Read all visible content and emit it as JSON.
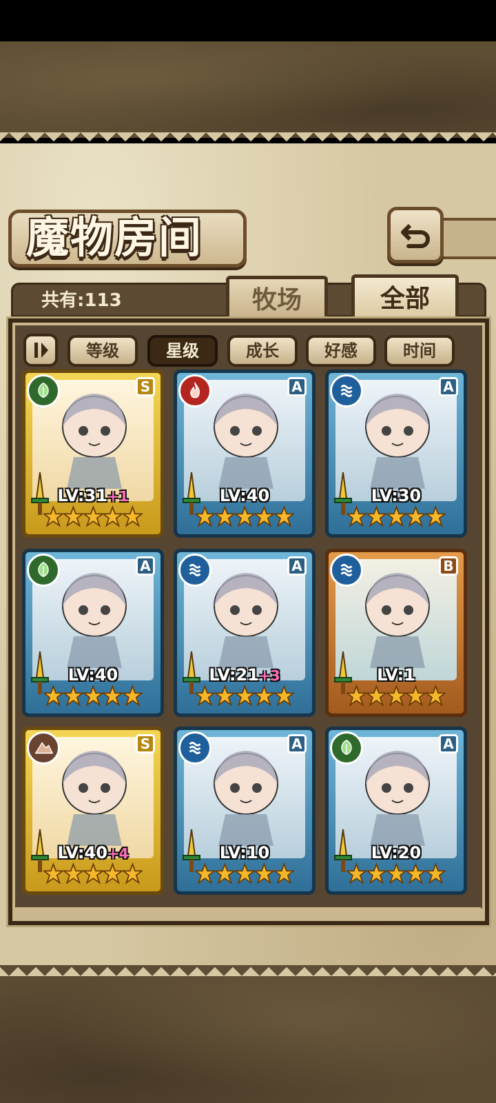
{
  "header": {
    "title": "魔物房间"
  },
  "summary": {
    "count_text": "共有:113"
  },
  "tabs": [
    {
      "label": "牧场",
      "active": false
    },
    {
      "label": "全部",
      "active": true
    }
  ],
  "sort": {
    "buttons": [
      {
        "label": "等级",
        "active": false
      },
      {
        "label": "星级",
        "active": true
      },
      {
        "label": "成长",
        "active": false
      },
      {
        "label": "好感",
        "active": false
      },
      {
        "label": "时间",
        "active": false
      }
    ]
  },
  "monsters": [
    {
      "element": "leaf",
      "rank": "S",
      "frame": "gold",
      "level": "LV:31",
      "bonus": "+1",
      "stars": 5
    },
    {
      "element": "fire",
      "rank": "A",
      "frame": "blue",
      "level": "LV:40",
      "bonus": "",
      "stars": 5
    },
    {
      "element": "water",
      "rank": "A",
      "frame": "blue",
      "level": "LV:30",
      "bonus": "",
      "stars": 5
    },
    {
      "element": "leaf",
      "rank": "A",
      "frame": "blue",
      "level": "LV:40",
      "bonus": "",
      "stars": 5
    },
    {
      "element": "water",
      "rank": "A",
      "frame": "blue",
      "level": "LV:21",
      "bonus": "+3",
      "stars": 5
    },
    {
      "element": "water",
      "rank": "B",
      "frame": "bronze",
      "level": "LV:1",
      "bonus": "",
      "stars": 5
    },
    {
      "element": "earth",
      "rank": "S",
      "frame": "gold",
      "level": "LV:40",
      "bonus": "+4",
      "stars": 5
    },
    {
      "element": "water",
      "rank": "A",
      "frame": "blue",
      "level": "LV:10",
      "bonus": "",
      "stars": 5
    },
    {
      "element": "leaf",
      "rank": "A",
      "frame": "blue",
      "level": "LV:20",
      "bonus": "",
      "stars": 5
    }
  ],
  "colors": {
    "parchment": "#d6c8a3",
    "frame_dark": "#3b2915",
    "star": "#f5b82a",
    "bonus": "#ff6fb8"
  }
}
